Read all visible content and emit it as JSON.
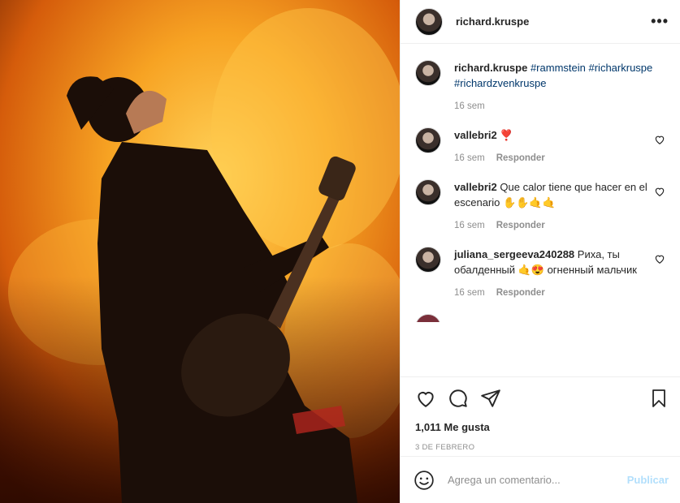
{
  "post": {
    "author": "richard.kruspe",
    "more_icon": "ellipsis-icon"
  },
  "caption": {
    "author": "richard.kruspe",
    "hashtags": [
      "#rammstein",
      "#richarkruspe",
      "#richardzvenkruspe"
    ],
    "time": "16 sem"
  },
  "comments": [
    {
      "user": "vallebri2",
      "text": "❣️",
      "time": "16 sem",
      "reply": "Responder"
    },
    {
      "user": "vallebri2",
      "text": "Que calor tiene que hacer en el escenario ✋✋🤙🤙",
      "time": "16 sem",
      "reply": "Responder"
    },
    {
      "user": "juliana_sergeeva240288",
      "text": "Риха, ты обалденный 🤙😍 огненный мальчик",
      "time": "16 sem",
      "reply": "Responder"
    }
  ],
  "stats": {
    "likes": "1,011 Me gusta",
    "date": "3 DE FEBRERO"
  },
  "add_comment": {
    "placeholder": "Agrega un comentario...",
    "publish": "Publicar"
  },
  "colors": {
    "link": "#00376b",
    "muted": "#8e8e8e",
    "publish_disabled": "#b2dffc"
  }
}
